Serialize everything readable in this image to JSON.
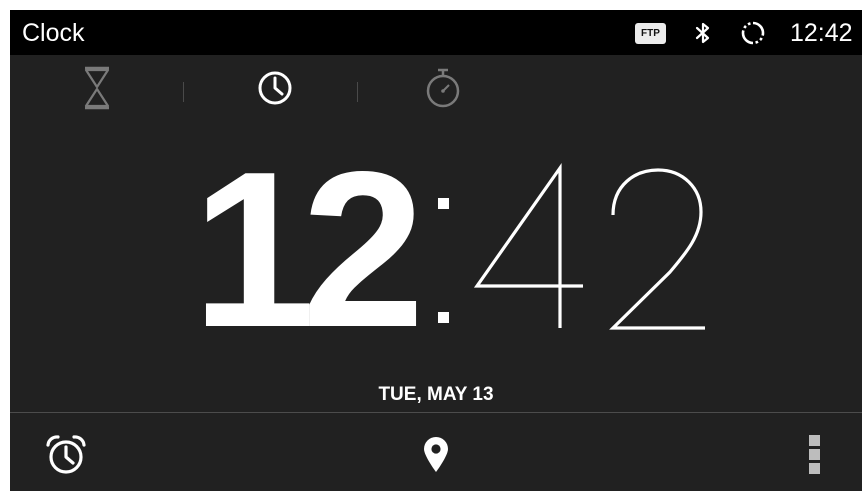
{
  "status_bar": {
    "app_title": "Clock",
    "ftp_badge": "FTP",
    "time": "12:42",
    "icons": [
      "bluetooth-icon",
      "sync-icon"
    ]
  },
  "tabs": [
    {
      "name": "timer",
      "icon": "hourglass-icon",
      "selected": false
    },
    {
      "name": "clock",
      "icon": "clock-icon",
      "selected": true
    },
    {
      "name": "stopwatch",
      "icon": "stopwatch-icon",
      "selected": false
    }
  ],
  "clock": {
    "hours": "12",
    "separator": ":",
    "minutes": "42",
    "date": "TUE, MAY 13"
  },
  "bottom_bar": {
    "icons": [
      "alarm-icon",
      "location-pin-icon",
      "overflow-menu-icon"
    ]
  },
  "colors": {
    "background": "#212121",
    "status_bar": "#000000",
    "selected_icon": "#ffffff",
    "unselected_icon": "#7a7a7a",
    "text": "#ffffff"
  }
}
